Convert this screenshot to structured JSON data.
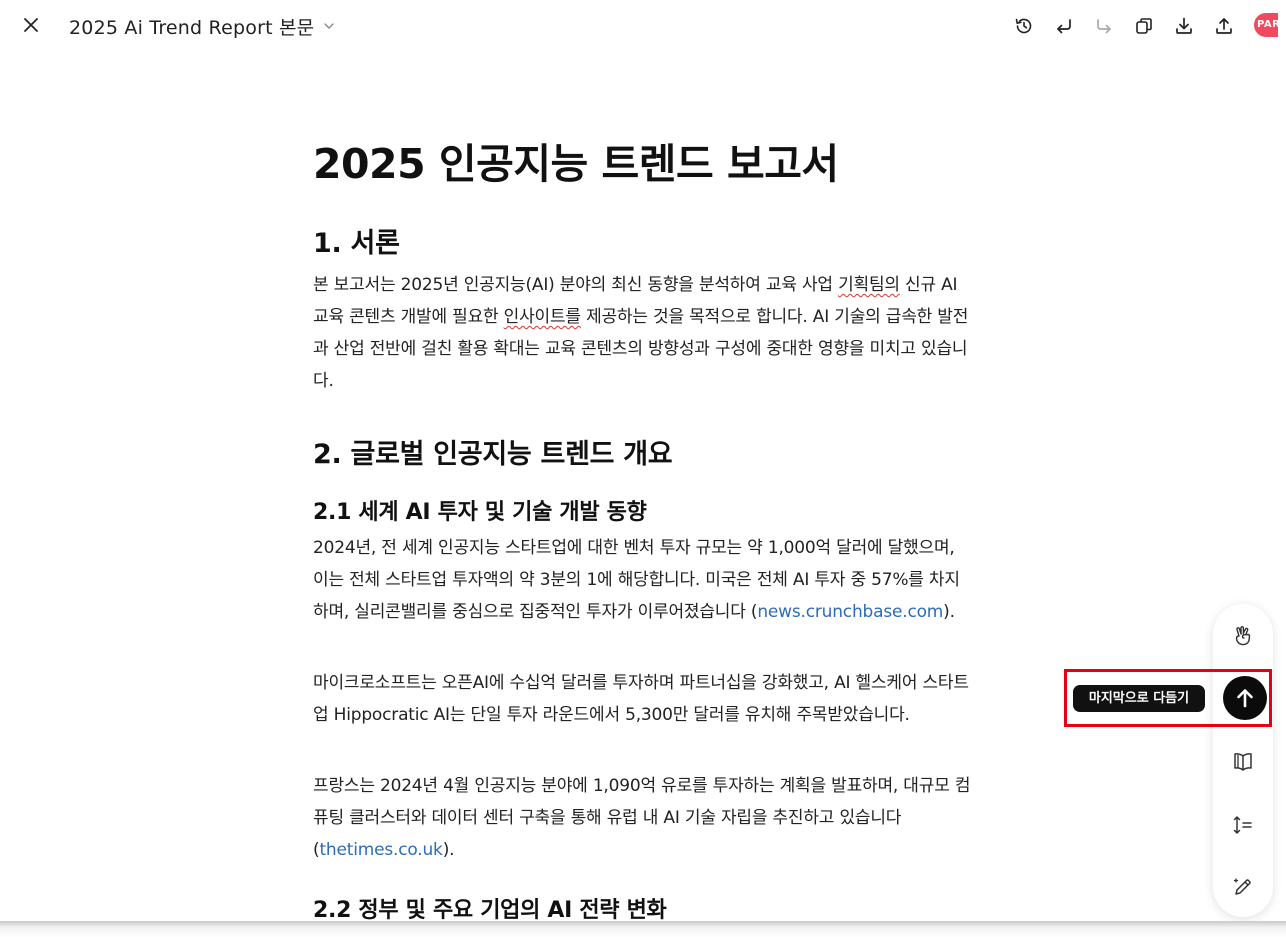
{
  "header": {
    "doc_title": "2025 Ai Trend Report 본문",
    "brand_text": "PAR",
    "toolbar_icons": [
      "history-icon",
      "undo-icon",
      "redo-icon",
      "copy-icon",
      "download-icon",
      "share-icon"
    ]
  },
  "document": {
    "title": "2025 인공지능 트렌드 보고서",
    "sections": {
      "intro_heading": "1. 서론",
      "intro_p_a": "본 보고서는 2025년 인공지능(AI) 분야의 최신 동향을 분석하여 교육 사업 ",
      "intro_p_sq1": "기획팀의",
      "intro_p_b": " 신규 AI 교육 콘텐츠 개발에 필요한 ",
      "intro_p_sq2": "인사이트를",
      "intro_p_c": " 제공하는 것을 목적으로 합니다. AI 기술의 급속한 발전과 산업 전반에 걸친 활용 확대는 교육 콘텐츠의 방향성과 구성에 중대한 영향을 미치고 있습니다.",
      "overview_heading": "2. 글로벌 인공지능 트렌드 개요",
      "sub21_heading": "2.1 세계 AI 투자 및 기술 개발 동향",
      "p1_text": "2024년, 전 세계 인공지능 스타트업에 대한 벤처 투자 규모는 약 1,000억 달러에 달했으며, 이는 전체 스타트업 투자액의 약 3분의 1에 해당합니다. 미국은 전체 AI 투자 중 57%를 차지하며, 실리콘밸리를 중심으로 집중적인 투자가 이루어졌습니다 (",
      "p1_link": "news.crunchbase.com",
      "p1_end": ").",
      "p2_text": "마이크로소프트는 오픈AI에 수십억 달러를 투자하며 파트너십을 강화했고, AI 헬스케어 스타트업 Hippocratic AI는 단일 투자 라운드에서 5,300만 달러를 유치해 주목받았습니다.",
      "p3_text": "프랑스는 2024년 4월 인공지능 분야에 1,090억 유로를 투자하는 계획을 발표하며, 대규모 컴퓨팅 클러스터와 데이터 센터 구축을 통해 유럽 내 AI 기술 자립을 추진하고 있습니다 (",
      "p3_link": "thetimes.co.uk",
      "p3_end": ").",
      "sub22_heading": "2.2 정부 및 주요 기업의 AI 전략 변화"
    }
  },
  "side_panel": {
    "tooltip": "마지막으로 다듬기",
    "icons": [
      "hand-gesture-icon",
      "arrow-up-icon",
      "book-icon",
      "line-spacing-icon",
      "magic-pen-icon"
    ]
  },
  "colors": {
    "link": "#2d6cb8",
    "highlight": "#e60012",
    "brand": "#ef4a5d"
  }
}
